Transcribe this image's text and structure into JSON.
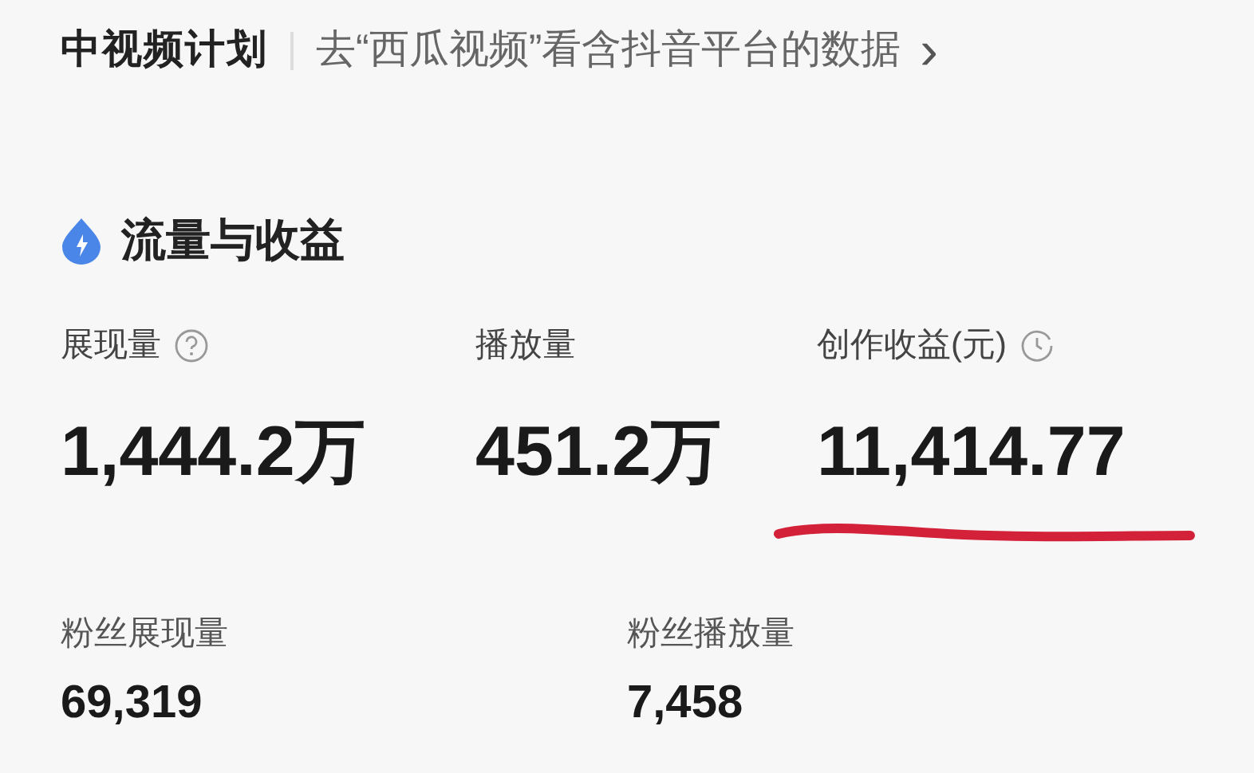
{
  "header": {
    "title": "中视频计划",
    "link": "去“西瓜视频”看含抖音平台的数据",
    "chevron": "›"
  },
  "section": {
    "title": "流量与收益"
  },
  "metrics": [
    {
      "label": "展现量",
      "value": "1,444.2万",
      "kind": "help",
      "underlined": false
    },
    {
      "label": "播放量",
      "value": "451.2万",
      "kind": "plain",
      "underlined": false
    },
    {
      "label": "创作收益(元)",
      "value": "11,414.77",
      "kind": "timed",
      "underlined": true
    }
  ],
  "fan_metrics": [
    {
      "label": "粉丝展现量",
      "value": "69,319"
    },
    {
      "label": "粉丝播放量",
      "value": "7,458"
    }
  ]
}
